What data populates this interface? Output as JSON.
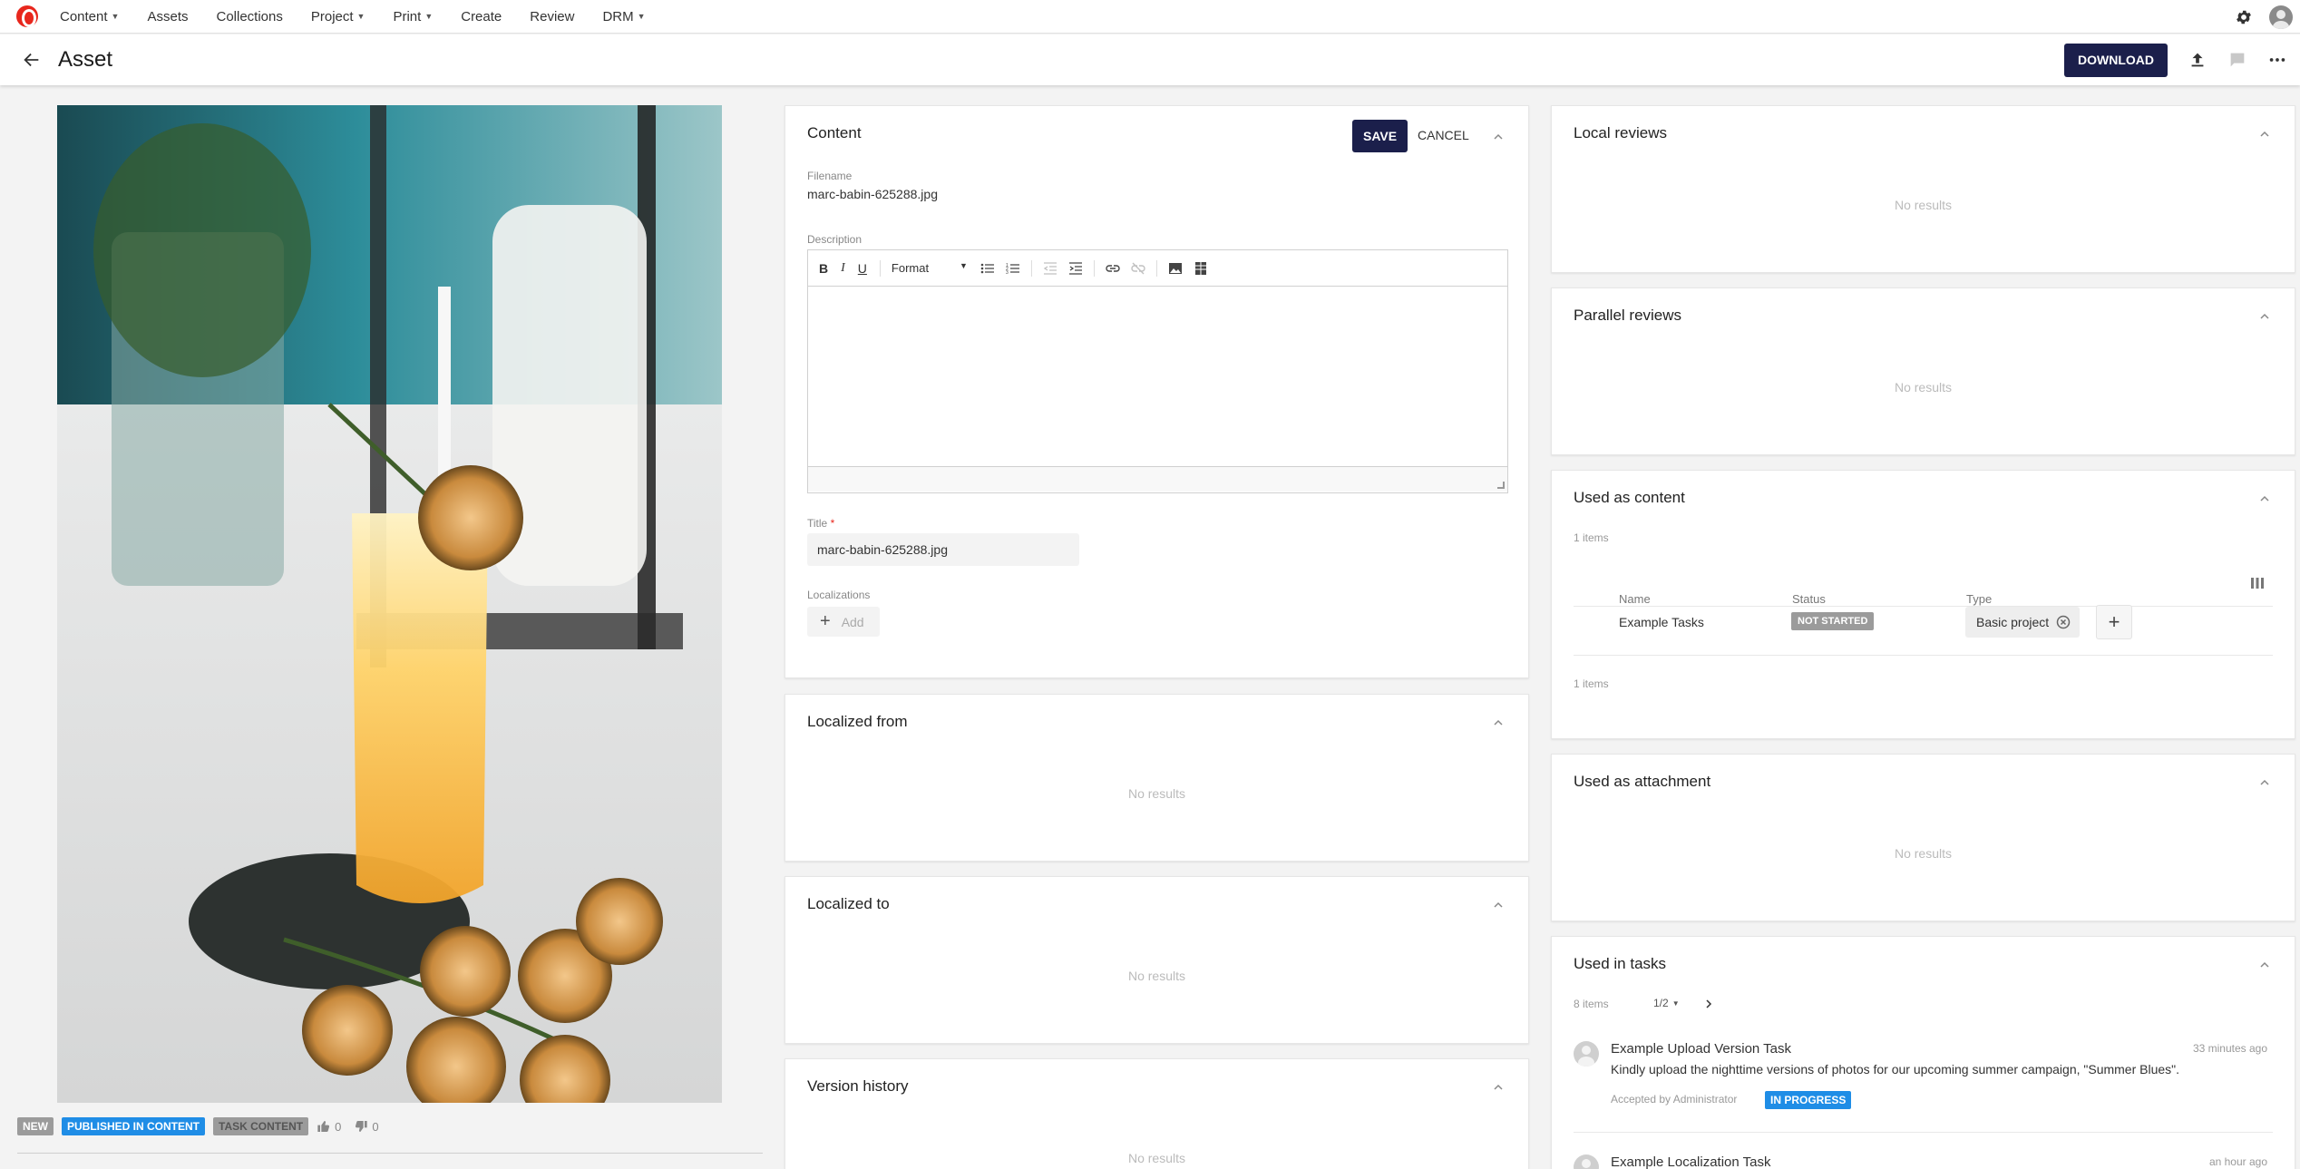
{
  "nav": {
    "items": [
      {
        "label": "Content",
        "dropdown": true
      },
      {
        "label": "Assets",
        "dropdown": false
      },
      {
        "label": "Collections",
        "dropdown": false
      },
      {
        "label": "Project",
        "dropdown": true
      },
      {
        "label": "Print",
        "dropdown": true
      },
      {
        "label": "Create",
        "dropdown": false
      },
      {
        "label": "Review",
        "dropdown": false
      },
      {
        "label": "DRM",
        "dropdown": true
      }
    ]
  },
  "header": {
    "title": "Asset",
    "download_label": "DOWNLOAD"
  },
  "asset": {
    "tags": {
      "new": "NEW",
      "published": "PUBLISHED IN CONTENT",
      "task": "TASK CONTENT"
    },
    "likes": "0",
    "dislikes": "0"
  },
  "content_card": {
    "title": "Content",
    "save_label": "SAVE",
    "cancel_label": "CANCEL",
    "filename_label": "Filename",
    "filename_value": "marc-babin-625288.jpg",
    "description_label": "Description",
    "format_label": "Format",
    "title_label": "Title",
    "title_required": "*",
    "title_value": "marc-babin-625288.jpg",
    "localizations_label": "Localizations",
    "add_label": "Add"
  },
  "localized_from": {
    "title": "Localized from",
    "empty": "No results"
  },
  "localized_to": {
    "title": "Localized to",
    "empty": "No results"
  },
  "version_history": {
    "title": "Version history",
    "empty": "No results"
  },
  "local_reviews": {
    "title": "Local reviews",
    "empty": "No results"
  },
  "parallel_reviews": {
    "title": "Parallel reviews",
    "empty": "No results"
  },
  "used_as_content": {
    "title": "Used as content",
    "count_top": "1 items",
    "count_bottom": "1 items",
    "columns": [
      "Name",
      "Status",
      "Type"
    ],
    "rows": [
      {
        "name": "Example Tasks",
        "status": "NOT STARTED",
        "type": "Basic project"
      }
    ]
  },
  "used_as_attachment": {
    "title": "Used as attachment",
    "empty": "No results"
  },
  "used_in_tasks": {
    "title": "Used in tasks",
    "count": "8 items",
    "page": "1/2",
    "tasks": [
      {
        "title": "Example Upload Version Task",
        "time": "33 minutes ago",
        "description": "Kindly upload the nighttime versions of photos for our upcoming summer campaign, \"Summer Blues\".",
        "meta": "Accepted by Administrator",
        "status": "IN PROGRESS"
      },
      {
        "title": "Example Localization Task",
        "time": "an hour ago"
      }
    ]
  },
  "colors": {
    "primary_dark": "#1b1f4b",
    "brand_red": "#e8271d",
    "status_blue": "#1f8de6",
    "status_grey": "#9b9b9b"
  }
}
